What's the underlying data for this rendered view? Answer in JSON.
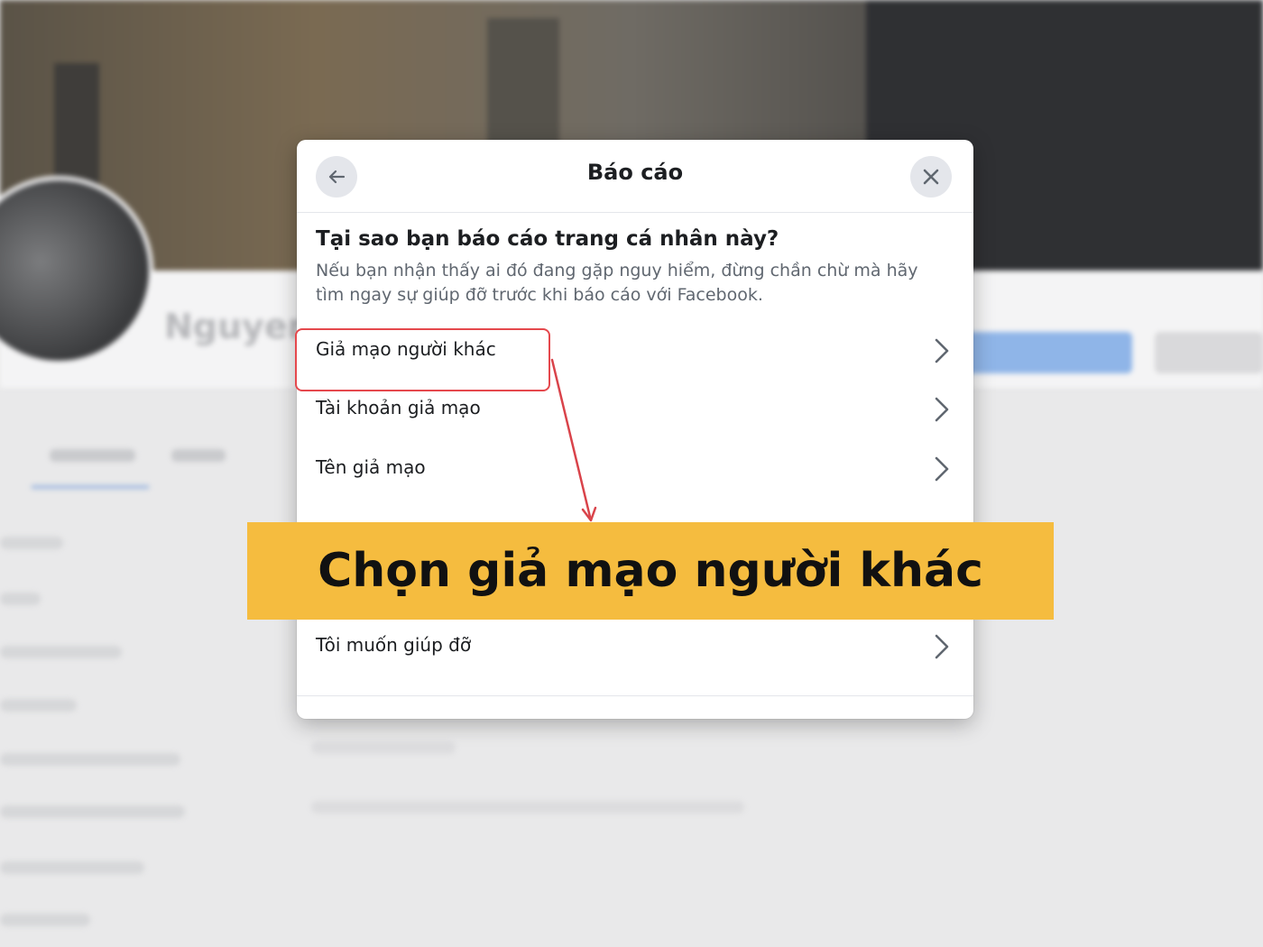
{
  "dialog": {
    "title": "Báo cáo",
    "back_icon": "arrow-left-icon",
    "close_icon": "close-icon",
    "question": "Tại sao bạn báo cáo trang cá nhân này?",
    "note": "Nếu bạn nhận thấy ai đó đang gặp nguy hiểm, đừng chần chừ mà hãy tìm ngay sự giúp đỡ trước khi báo cáo với Facebook.",
    "options": [
      {
        "label": "Giả mạo người khác",
        "highlighted": true
      },
      {
        "label": "Tài khoản giả mạo"
      },
      {
        "label": "Tên giả mạo"
      },
      {
        "label": "Tôi muốn giúp đỡ"
      }
    ]
  },
  "annotation": {
    "banner_text": "Chọn giả mạo người khác",
    "banner_color": "#f5bc3f",
    "highlight_color": "#e5484d"
  },
  "background": {
    "partial_name": "Nguyen"
  }
}
